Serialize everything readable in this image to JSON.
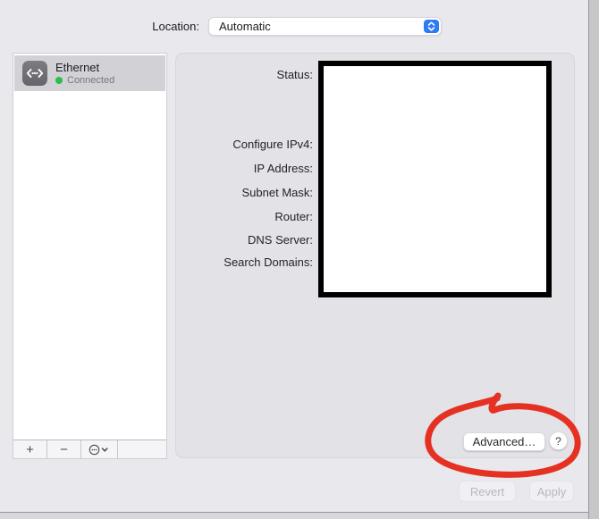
{
  "header": {
    "location_label": "Location:",
    "location_value": "Automatic"
  },
  "sidebar": {
    "items": [
      {
        "name": "Ethernet",
        "status": "Connected",
        "selected": true
      }
    ],
    "toolbar": {
      "add_label": "+",
      "remove_label": "−"
    }
  },
  "panel": {
    "fields": [
      {
        "label": "Status:"
      },
      {
        "label": "Configure IPv4:"
      },
      {
        "label": "IP Address:"
      },
      {
        "label": "Subnet Mask:"
      },
      {
        "label": "Router:"
      },
      {
        "label": "DNS Server:"
      },
      {
        "label": "Search Domains:"
      }
    ],
    "advanced_button_label": "Advanced…",
    "help_button_label": "?"
  },
  "footer": {
    "revert_label": "Revert",
    "apply_label": "Apply"
  },
  "annotations": {
    "red_circle_color": "#e43122"
  },
  "colors": {
    "accent_blue": "#2d7cf6",
    "status_green": "#2dbd4e",
    "redaction_border": "#000000",
    "selected_row": "#d2d1d6"
  }
}
